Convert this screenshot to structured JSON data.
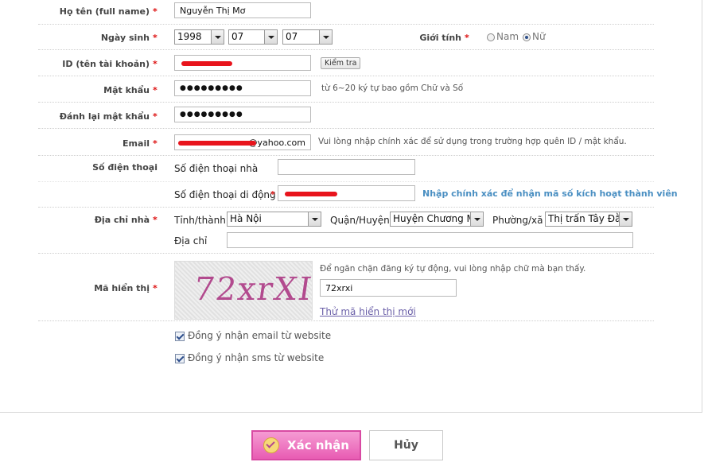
{
  "form": {
    "fullname": {
      "label": "Họ tên (full name)",
      "required": "*",
      "value": "Nguyễn Thị Mơ"
    },
    "birthday": {
      "label": "Ngày sinh",
      "required": "*",
      "year": "1998",
      "month": "07",
      "day": "07"
    },
    "gender": {
      "label": "Giới tính",
      "required": "*",
      "male": "Nam",
      "female": "Nữ",
      "selected": "Nữ"
    },
    "account_id": {
      "label": "ID (tên tài khoản)",
      "required": "*",
      "check_button": "Kiểm tra"
    },
    "password": {
      "label": "Mật khẩu",
      "required": "*",
      "value": "●●●●●●●●●",
      "hint": "từ 6~20 ký tự bao gồm Chữ và Số"
    },
    "password_confirm": {
      "label": "Đánh lại mật khẩu",
      "required": "*",
      "value": "●●●●●●●●●"
    },
    "email": {
      "label": "Email",
      "required": "*",
      "value_suffix": "@yahoo.com",
      "hint": "Vui lòng nhập chính xác để sử dụng trong trường hợp quên ID / mật khẩu."
    },
    "phone": {
      "label": "Số điện thoại",
      "home_label": "Số điện thoại nhà",
      "mobile_label": "Số điện thoại di động",
      "mobile_required": "*",
      "mobile_hint": "Nhập chính xác để nhận mã số kích hoạt thành viên"
    },
    "address": {
      "label": "Địa chỉ nhà",
      "required": "*",
      "province_label": "Tỉnh/thành",
      "province": "Hà Nội",
      "district_label": "Quận/Huyện",
      "district": "Huyện Chương Mỹ",
      "ward_label": "Phường/xã",
      "ward": "Thị trấn Tây Đằng",
      "street_label": "Địa chỉ"
    },
    "captcha": {
      "label": "Mã hiển thị",
      "required": "*",
      "image_text": "72xrXI",
      "hint": "Để ngăn chặn đăng ký tự động, vui lòng nhập chữ mà bạn thấy.",
      "value": "72xrxi",
      "refresh_link": "Thử mã hiển thị mới"
    },
    "consents": [
      {
        "label": "Đồng ý nhận email từ website",
        "checked": true
      },
      {
        "label": "Đồng ý nhận sms từ website",
        "checked": true
      }
    ]
  },
  "actions": {
    "confirm": "Xác nhận",
    "cancel": "Hủy"
  },
  "colors": {
    "accent_pink": "#e85cb3",
    "required_red": "#d11111",
    "hint_blue": "#4a8fc2",
    "link_purple": "#6a5fa8"
  }
}
